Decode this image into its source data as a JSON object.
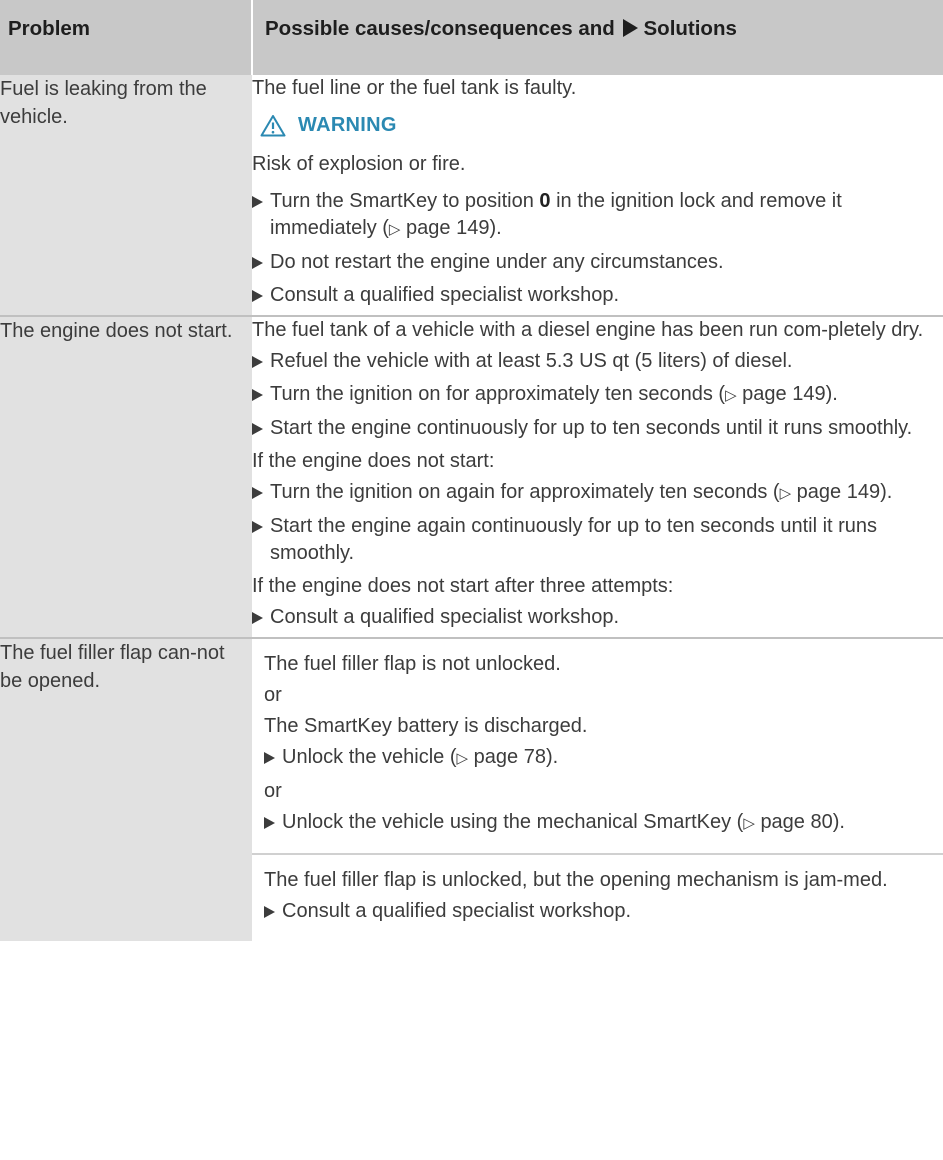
{
  "header": {
    "problem": "Problem",
    "solution_prefix": "Possible causes/consequences and",
    "solution_suffix": "Solutions"
  },
  "rows": [
    {
      "problem": "Fuel is leaking from the vehicle.",
      "cause": "The fuel line or the fuel tank is faulty.",
      "warning_title": "WARNING",
      "warning_text": "Risk of explosion or fire.",
      "step1_a": "Turn the SmartKey to position",
      "step1_key": "0",
      "step1_b": "in the ignition lock and remove it immediately (",
      "step1_ref": "page 149",
      "step1_c": ").",
      "step2": "Do not restart the engine under any circumstances.",
      "step3": "Consult a qualified specialist workshop."
    },
    {
      "problem": "The engine does not start.",
      "cause": "The fuel tank of a vehicle with a diesel engine has been run com-pletely dry.",
      "step1": "Refuel the vehicle with at least 5.3 US qt (5 liters) of diesel.",
      "step2_a": "Turn the ignition on for approximately ten seconds (",
      "step2_ref": "page 149",
      "step2_b": ").",
      "step3": "Start the engine continuously for up to ten seconds until it runs smoothly.",
      "cond1": "If the engine does not start:",
      "step4_a": "Turn the ignition on again for approximately ten seconds (",
      "step4_ref": "page 149",
      "step4_b": ").",
      "step5": "Start the engine again continuously for up to ten seconds until it runs smoothly.",
      "cond2": "If the engine does not start after three attempts:",
      "step6": "Consult a qualified specialist workshop."
    },
    {
      "problem": "The fuel filler flap can-not be opened.",
      "cause1": "The fuel filler flap is not unlocked.",
      "or1": "or",
      "cause2": "The SmartKey battery is discharged.",
      "step1_a": "Unlock the vehicle (",
      "step1_ref": "page 78",
      "step1_b": ").",
      "or2": "or",
      "step2_a": "Unlock the vehicle using the mechanical SmartKey (",
      "step2_ref": "page 80",
      "step2_b": ").",
      "cause3": "The fuel filler flap is unlocked, but the opening mechanism is jam-med.",
      "step3": "Consult a qualified specialist workshop."
    }
  ],
  "icons": {
    "bullet": "triangle-right-icon",
    "warning": "warning-triangle-icon",
    "page_ref": "page-reference-icon"
  },
  "colors": {
    "header_bg": "#c8c8c8",
    "problem_bg": "#e1e1e1",
    "warning_title": "#2b89b2",
    "text": "#3c3c3c"
  }
}
